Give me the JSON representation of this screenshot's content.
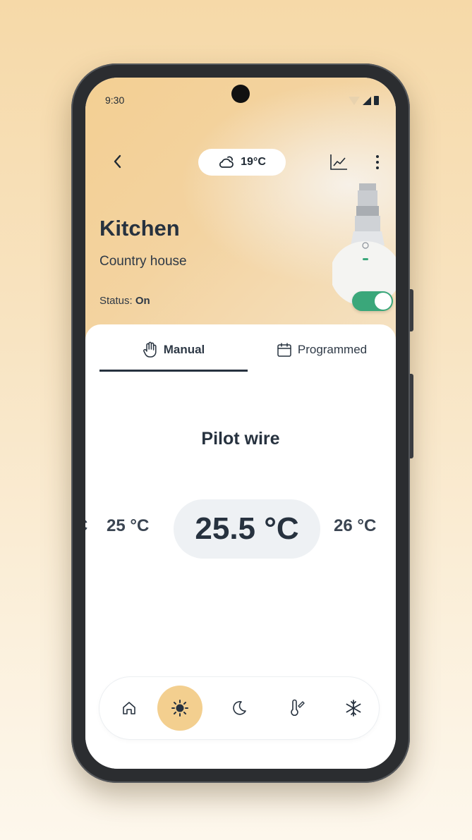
{
  "status_bar": {
    "time": "9:30"
  },
  "header": {
    "weather": {
      "icon": "cloud-sun-icon",
      "temperature": "19°C"
    }
  },
  "room": {
    "name": "Kitchen",
    "location": "Country house",
    "status_label": "Status:",
    "status_value": "On",
    "power_on": true
  },
  "tabs": [
    {
      "label": "Manual",
      "icon": "hand-icon",
      "active": true
    },
    {
      "label": "Programmed",
      "icon": "calendar-icon",
      "active": false
    }
  ],
  "mode_title": "Pilot wire",
  "temperature_picker": {
    "far_left": "C",
    "previous": "25 °C",
    "selected": "25.5 °C",
    "next": "26 °C"
  },
  "modes": [
    {
      "icon": "home-icon",
      "active": false
    },
    {
      "icon": "sun-icon",
      "active": true
    },
    {
      "icon": "moon-icon",
      "active": false
    },
    {
      "icon": "thermometer-icon",
      "active": false
    },
    {
      "icon": "snowflake-icon",
      "active": false
    }
  ],
  "colors": {
    "accent": "#f3cf8f",
    "toggle_on": "#3aa77a",
    "text_dark": "#27323f"
  }
}
